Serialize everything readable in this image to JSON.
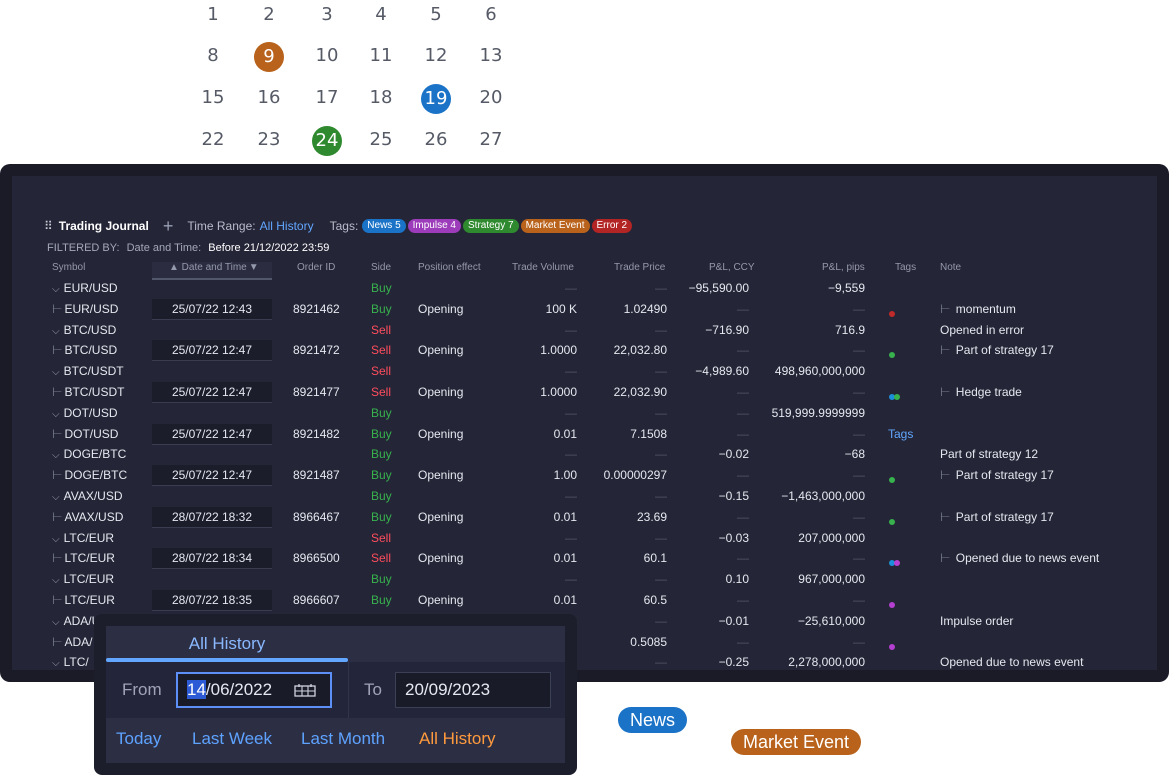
{
  "calendar": {
    "rows": [
      [
        "1",
        "2",
        "3",
        "4",
        "5",
        "6"
      ],
      [
        "8",
        "9",
        "10",
        "11",
        "12",
        "13"
      ],
      [
        "15",
        "16",
        "17",
        "18",
        "19",
        "20"
      ],
      [
        "22",
        "23",
        "24",
        "25",
        "26",
        "27"
      ]
    ],
    "highlights": {
      "9": "#b8621b",
      "19": "#1b73c7",
      "24": "#2f8a2f"
    }
  },
  "toolbar": {
    "drag_icon": "⠿",
    "title": "Trading Journal",
    "plus": "+",
    "time_range_label": "Time Range:",
    "time_range_value": "All History",
    "tags_label": "Tags:",
    "tags": [
      {
        "label": "News 5",
        "color": "#1b73c7"
      },
      {
        "label": "Impulse 4",
        "color": "#9c3cba"
      },
      {
        "label": "Strategy 7",
        "color": "#2f8a2f"
      },
      {
        "label": "Market Event",
        "color": "#b8621b"
      },
      {
        "label": "Error 2",
        "color": "#b32424"
      }
    ]
  },
  "filter": {
    "prefix": "FILTERED BY:",
    "key": "Date and Time:",
    "value": "Before 21/12/2022 23:59"
  },
  "table": {
    "headers": {
      "symbol": "Symbol",
      "datetime": "▲ Date and Time",
      "order_id": "Order ID",
      "side": "Side",
      "position_effect": "Position effect",
      "volume": "Trade Volume",
      "price": "Trade Price",
      "pl_ccy": "P&L, CCY",
      "pl_pips": "P&L, pips",
      "tags": "Tags",
      "note": "Note"
    },
    "rows": [
      {
        "type": "parent",
        "symbol": "EUR/USD",
        "side": "Buy",
        "pl_ccy": "−95,590.00",
        "pl_pips": "−9,559",
        "note": ""
      },
      {
        "type": "child",
        "symbol": "EUR/USD",
        "datetime": "25/07/22 12:43",
        "order_id": "8921462",
        "side": "Buy",
        "effect": "Opening",
        "volume": "100 K",
        "price": "1.02490",
        "dots": [
          "#c02a2a"
        ],
        "note": "momentum"
      },
      {
        "type": "parent",
        "symbol": "BTC/USD",
        "side": "Sell",
        "pl_ccy": "−716.90",
        "pl_pips": "716.9",
        "note": "Opened in error"
      },
      {
        "type": "child",
        "symbol": "BTC/USD",
        "datetime": "25/07/22 12:47",
        "order_id": "8921472",
        "side": "Sell",
        "effect": "Opening",
        "volume": "1.0000",
        "price": "22,032.80",
        "dots": [
          "#37b24d"
        ],
        "note": "Part of strategy 17"
      },
      {
        "type": "parent",
        "symbol": "BTC/USDT",
        "side": "Sell",
        "pl_ccy": "−4,989.60",
        "pl_pips": "498,960,000,000",
        "note": ""
      },
      {
        "type": "child",
        "symbol": "BTC/USDT",
        "datetime": "25/07/22 12:47",
        "order_id": "8921477",
        "side": "Sell",
        "effect": "Opening",
        "volume": "1.0000",
        "price": "22,032.90",
        "dots": [
          "#1b8fd9",
          "#37b24d"
        ],
        "note": "Hedge trade"
      },
      {
        "type": "parent",
        "symbol": "DOT/USD",
        "side": "Buy",
        "pl_ccy": "—",
        "pl_pips": "519,999.9999999",
        "note": ""
      },
      {
        "type": "child",
        "symbol": "DOT/USD",
        "datetime": "25/07/22 12:47",
        "order_id": "8921482",
        "side": "Buy",
        "effect": "Opening",
        "volume": "0.01",
        "price": "7.1508",
        "tags_text": "Tags",
        "note": ""
      },
      {
        "type": "parent",
        "symbol": "DOGE/BTC",
        "side": "Buy",
        "pl_ccy": "−0.02",
        "pl_pips": "−68",
        "note": "Part of strategy 12"
      },
      {
        "type": "child",
        "symbol": "DOGE/BTC",
        "datetime": "25/07/22 12:47",
        "order_id": "8921487",
        "side": "Buy",
        "effect": "Opening",
        "volume": "1.00",
        "price": "0.00000297",
        "dots": [
          "#37b24d"
        ],
        "note": "Part of strategy 17"
      },
      {
        "type": "parent",
        "symbol": "AVAX/USD",
        "side": "Buy",
        "pl_ccy": "−0.15",
        "pl_pips": "−1,463,000,000",
        "note": ""
      },
      {
        "type": "child",
        "symbol": "AVAX/USD",
        "datetime": "28/07/22 18:32",
        "order_id": "8966467",
        "side": "Buy",
        "effect": "Opening",
        "volume": "0.01",
        "price": "23.69",
        "dots": [
          "#37b24d"
        ],
        "note": "Part of strategy 17"
      },
      {
        "type": "parent",
        "symbol": "LTC/EUR",
        "side": "Sell",
        "pl_ccy": "−0.03",
        "pl_pips": "207,000,000",
        "note": ""
      },
      {
        "type": "child",
        "symbol": "LTC/EUR",
        "datetime": "28/07/22 18:34",
        "order_id": "8966500",
        "side": "Sell",
        "effect": "Opening",
        "volume": "0.01",
        "price": "60.1",
        "dots": [
          "#1b8fd9",
          "#b43fd0"
        ],
        "note": "Opened due to news event"
      },
      {
        "type": "parent",
        "symbol": "LTC/EUR",
        "side": "Buy",
        "pl_ccy": "0.10",
        "pl_pips": "967,000,000",
        "note": ""
      },
      {
        "type": "child",
        "symbol": "LTC/EUR",
        "datetime": "28/07/22 18:35",
        "order_id": "8966607",
        "side": "Buy",
        "effect": "Opening",
        "volume": "0.01",
        "price": "60.5",
        "dots": [
          "#b43fd0"
        ],
        "note": ""
      },
      {
        "type": "parent",
        "symbol": "ADA/USD",
        "side": "Buy",
        "pl_ccy": "−0.01",
        "pl_pips": "−25,610,000",
        "note": "Impulse order"
      },
      {
        "type": "child",
        "symbol": "ADA/",
        "datetime": "",
        "order_id": "",
        "side": "",
        "effect": "",
        "volume": "",
        "price": "0.5085",
        "dots": [
          "#b43fd0"
        ],
        "note": ""
      },
      {
        "type": "parent",
        "symbol": "LTC/",
        "side": "",
        "pl_ccy": "−0.25",
        "pl_pips": "2,278,000,000",
        "note": "Opened due to news event"
      }
    ]
  },
  "date_popup": {
    "tab": "All History",
    "from_label": "From",
    "from_value_selected": "14",
    "from_value_rest": "/06/2022",
    "to_label": "To",
    "to_value": "20/09/2023",
    "quick": [
      "Today",
      "Last Week",
      "Last Month",
      "All History"
    ]
  },
  "floating_tags": [
    {
      "label": "News",
      "color": "#1b73c7"
    },
    {
      "label": "Market Event",
      "color": "#b8621b"
    }
  ]
}
